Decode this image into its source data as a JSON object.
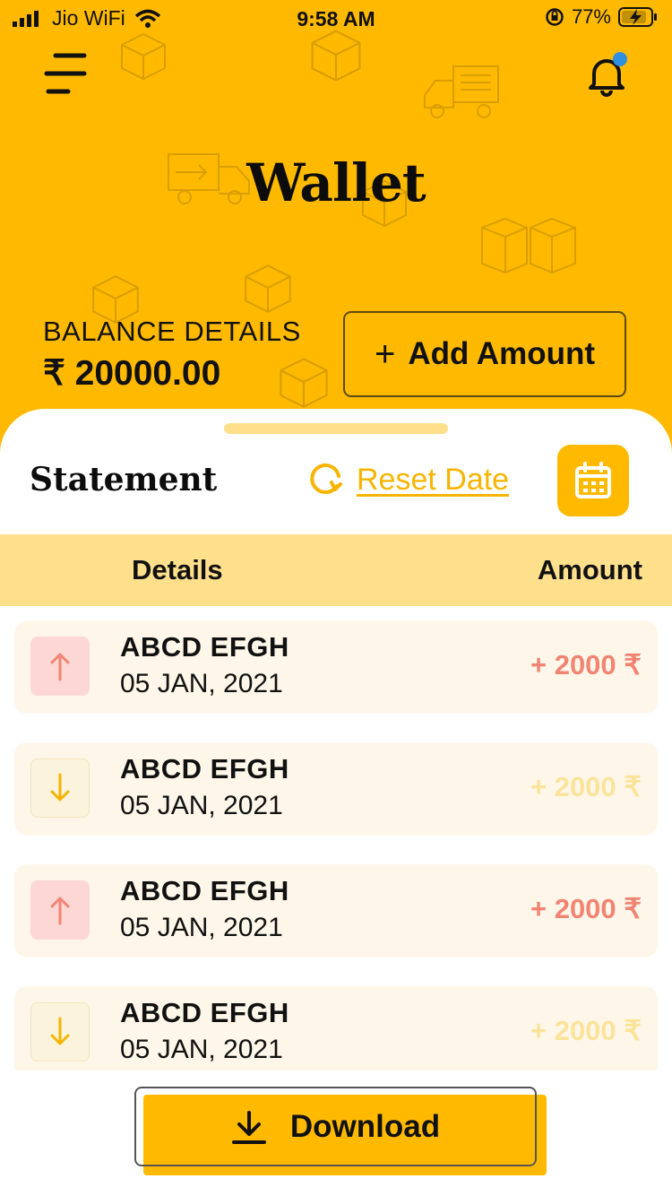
{
  "status_bar": {
    "carrier": "Jio WiFi",
    "time": "9:58 AM",
    "battery": "77%"
  },
  "header": {
    "title": "Wallet",
    "menu_icon": "menu-icon",
    "bell_icon": "bell-icon"
  },
  "balance": {
    "label": "BALANCE DETAILS",
    "amount": "₹ 20000.00",
    "add_button_label": "Add Amount"
  },
  "statement": {
    "title": "Statement",
    "reset_label": "Reset Date",
    "calendar_icon": "calendar-icon"
  },
  "table": {
    "col_details": "Details",
    "col_amount": "Amount"
  },
  "transactions": [
    {
      "name": "ABCD EFGH",
      "date": "05 JAN, 2021",
      "amount": "+ 2000 ₹",
      "direction": "up"
    },
    {
      "name": "ABCD EFGH",
      "date": "05 JAN, 2021",
      "amount": "+ 2000 ₹",
      "direction": "down"
    },
    {
      "name": "ABCD EFGH",
      "date": "05 JAN, 2021",
      "amount": "+ 2000 ₹",
      "direction": "up"
    },
    {
      "name": "ABCD EFGH",
      "date": "05 JAN, 2021",
      "amount": "+ 2000 ₹",
      "direction": "down"
    }
  ],
  "download": {
    "label": "Download",
    "icon": "download-icon"
  },
  "colors": {
    "brand": "#FFBA00",
    "credit": "#F18473",
    "debit": "#FBE39A",
    "notification_dot": "#2F8FE0"
  }
}
